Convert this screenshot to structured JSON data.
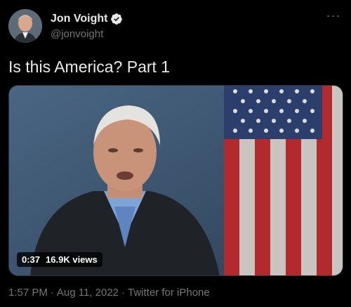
{
  "user": {
    "name": "Jon Voight",
    "handle": "@jonvoight",
    "verified_icon": "verified-badge-icon",
    "more_icon": "more-horizontal-icon"
  },
  "tweet": {
    "text": "Is this America? Part 1"
  },
  "video": {
    "duration": "0:37",
    "views": "16.9K views"
  },
  "meta": {
    "time": "1:57 PM",
    "separator": "·",
    "date": "Aug 11, 2022",
    "source": "Twitter for iPhone"
  },
  "colors": {
    "background": "#000000",
    "text": "#e7e9ea",
    "secondary": "#71767b",
    "verified": "#e7e9ea"
  }
}
